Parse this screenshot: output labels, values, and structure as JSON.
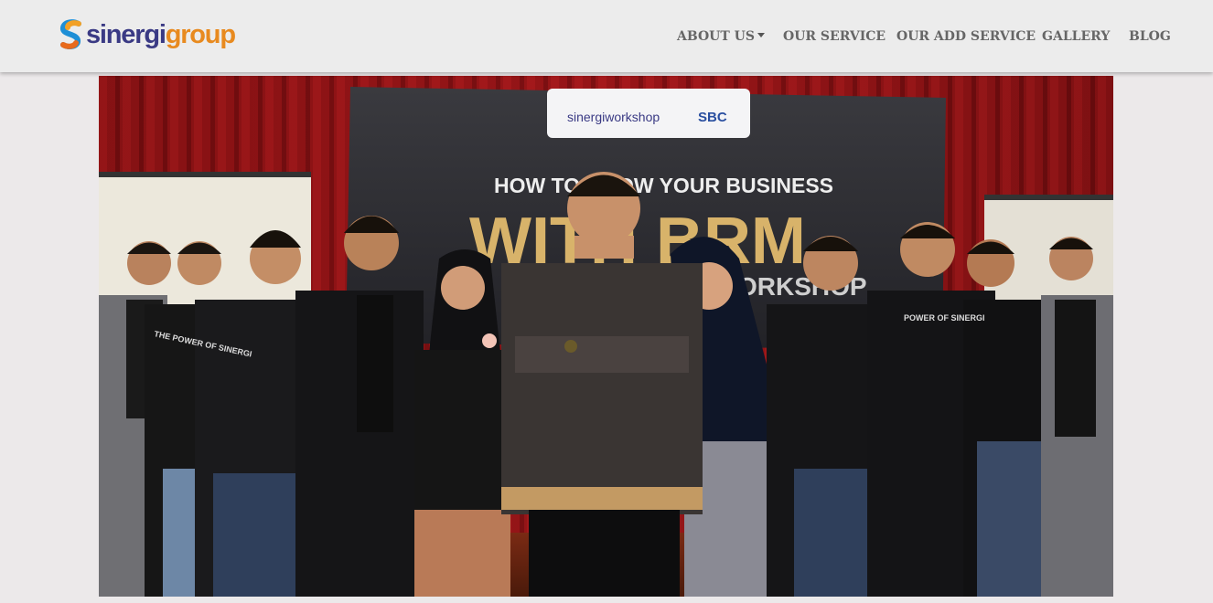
{
  "brand": {
    "name_part1": "sinergi",
    "name_part2": "group",
    "primary_color": "#3a3a84",
    "accent_color": "#e88a1f"
  },
  "nav": {
    "items": [
      {
        "label": "ABOUT US",
        "has_dropdown": true
      },
      {
        "label": "OUR SERVICE",
        "has_dropdown": false
      },
      {
        "label": "OUR ADD SERVICE",
        "has_dropdown": false
      },
      {
        "label": "GALLERY",
        "has_dropdown": false
      },
      {
        "label": "BLOG",
        "has_dropdown": false
      }
    ]
  },
  "hero": {
    "banner_logo_left": "sinergiworkshop",
    "banner_logo_right": "SBC",
    "banner_line1": "HOW TO GROW YOUR BUSINESS",
    "banner_line2": "WITH BRM",
    "banner_line3": "BRM WORKSHOP",
    "tee_left": "THE POWER OF SINERGI",
    "tee_right": "POWER OF SINERGI"
  }
}
